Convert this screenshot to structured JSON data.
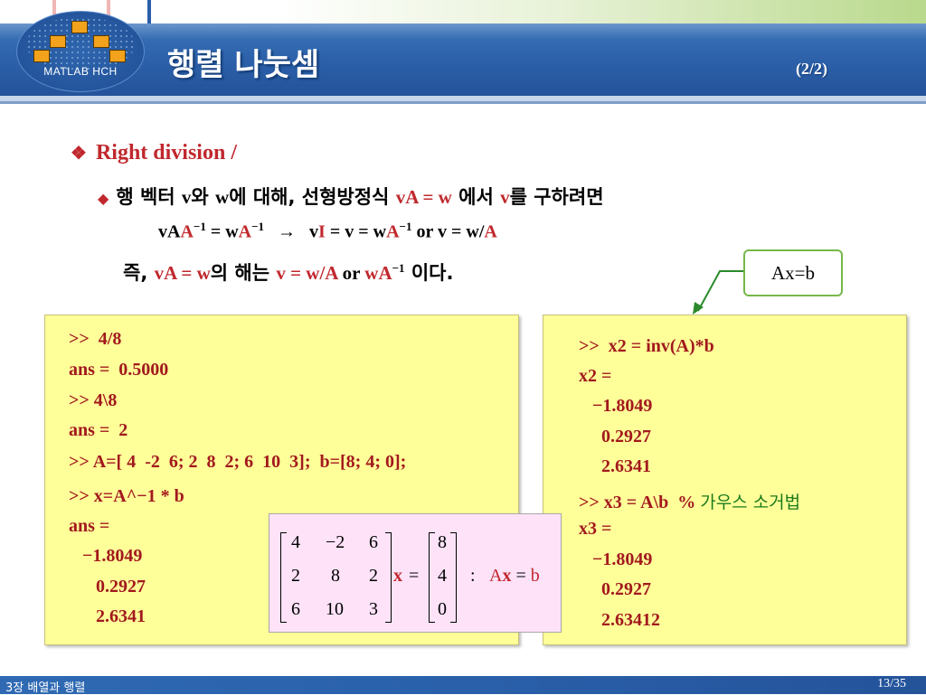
{
  "slide": {
    "title": "행렬 나눗셈",
    "page_indicator": "(2/2)",
    "logo_text": "MATLAB HCH",
    "footer_left": "3장 배열과 행렬",
    "footer_right": "13/35"
  },
  "bullets": {
    "main": "Right division  /",
    "sub_a": "행 벡터 ",
    "sub_v": "v",
    "sub_b": "와 ",
    "sub_w": "w",
    "sub_c": "에 대해,  선형방정식  ",
    "sub_eq": "vA = w",
    "sub_d": " 에서 ",
    "sub_v2": "v",
    "sub_e": "를 구하려면",
    "l3_a": "vA",
    "l3_b": "A",
    "l3_c": " = w",
    "l3_d": "A",
    "l3_e": "   →   v",
    "l3_f": "I",
    "l3_g": " = v = w",
    "l3_h": "A",
    "l3_i": " or  v = w/",
    "l3_j": "A",
    "sup": "−1",
    "l4_a": "즉,  ",
    "l4_b": "vA = w",
    "l4_c": "의 해는 ",
    "l4_d": "v = w/A",
    "l4_e": " or ",
    "l4_f": "wA",
    "l4_g": " 이다."
  },
  "callout": "Ax=b",
  "left_code": [
    ">>  4/8",
    "ans =  0.5000",
    ">> 4\\8",
    "ans =  2",
    ">> A=[ 4  -2  6; 2  8  2; 6  10  3];  b=[8; 4; 0];",
    ">> x=A^−1 * b",
    "ans =",
    "   −1.8049",
    "      0.2927",
    "      2.6341"
  ],
  "right_code": {
    "line1": ">>  x2 = inv(A)*b",
    "line2": "x2 =",
    "line3": "   −1.8049",
    "line4": "     0.2927",
    "line5": "     2.6341",
    "line6_cmd": ">> x3 = A\\b  % ",
    "line6_comment": "가우스 소거법",
    "line7": "x3 =",
    "line8": "   −1.8049",
    "line9": "     0.2927",
    "line10": "     2.63412"
  },
  "matrix": {
    "A": [
      [
        "4",
        "−2",
        "6"
      ],
      [
        "2",
        "8",
        "2"
      ],
      [
        "6",
        "10",
        "3"
      ]
    ],
    "b": [
      "8",
      "4",
      "0"
    ],
    "x_label": "x",
    "eq": "=",
    "colon": ":",
    "ax_A": "A",
    "ax_x": "x",
    "ax_eq": " = ",
    "ax_b": "b"
  },
  "colors": {
    "header_blue": "#2a5ea6",
    "code_red": "#a2191e",
    "box_yellow": "#ffff99",
    "accent_green": "#76b84a"
  }
}
